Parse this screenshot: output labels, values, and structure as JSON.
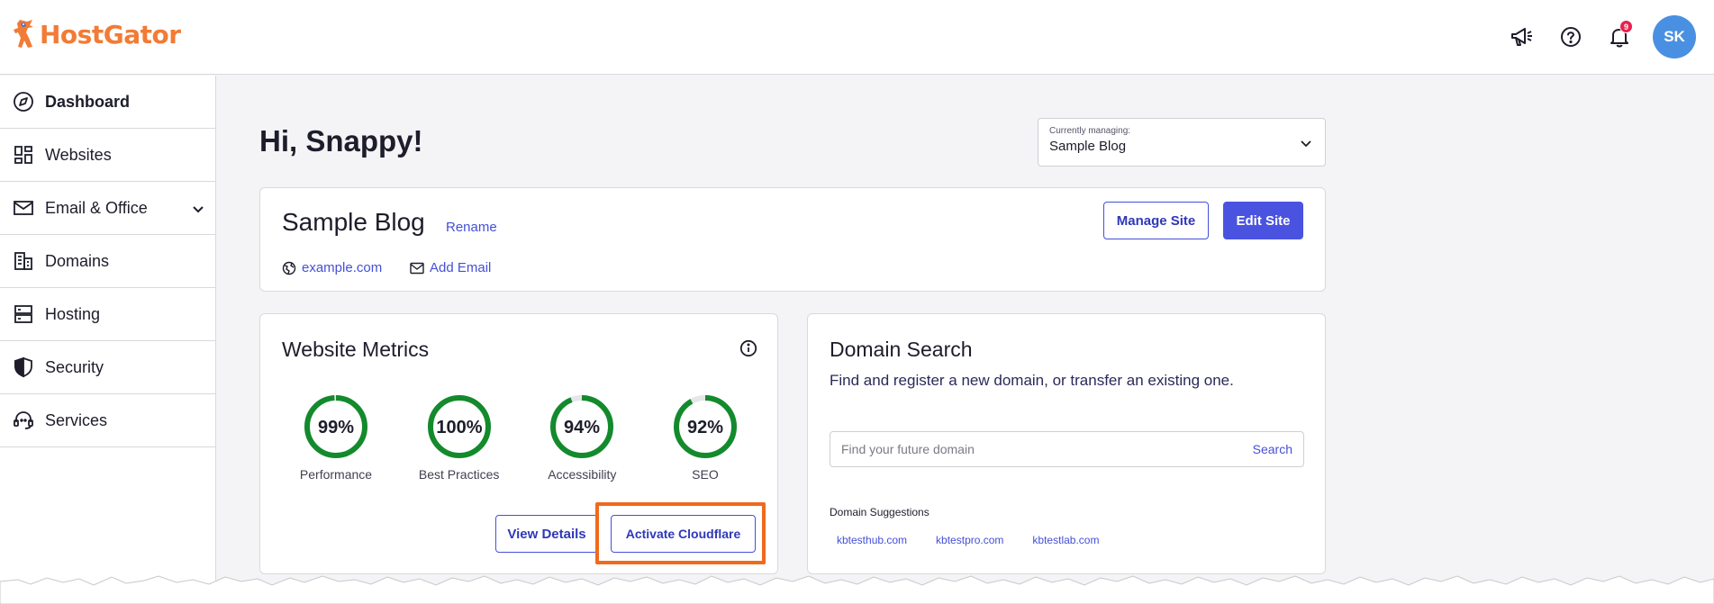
{
  "brand": {
    "name": "HostGator",
    "color": "#f27b35"
  },
  "header": {
    "icons": [
      "megaphone-icon",
      "help-icon",
      "bell-icon"
    ],
    "notification_count": "9",
    "avatar_initials": "SK"
  },
  "sidebar": {
    "items": [
      {
        "label": "Dashboard",
        "icon": "compass-icon",
        "active": true
      },
      {
        "label": "Websites",
        "icon": "grid-icon"
      },
      {
        "label": "Email & Office",
        "icon": "mail-icon",
        "expandable": true
      },
      {
        "label": "Domains",
        "icon": "building-icon"
      },
      {
        "label": "Hosting",
        "icon": "server-icon"
      },
      {
        "label": "Security",
        "icon": "shield-icon"
      },
      {
        "label": "Services",
        "icon": "support-agent-icon"
      }
    ]
  },
  "main": {
    "greeting": "Hi, Snappy!",
    "managing": {
      "label": "Currently managing:",
      "value": "Sample Blog"
    },
    "site": {
      "title": "Sample Blog",
      "rename": "Rename",
      "domain": "example.com",
      "add_email": "Add Email",
      "manage_button": "Manage Site",
      "edit_button": "Edit Site"
    },
    "metrics": {
      "title": "Website Metrics",
      "items": [
        {
          "label": "Performance",
          "value": "99%",
          "fraction": 0.99
        },
        {
          "label": "Best Practices",
          "value": "100%",
          "fraction": 1.0
        },
        {
          "label": "Accessibility",
          "value": "94%",
          "fraction": 0.94
        },
        {
          "label": "SEO",
          "value": "92%",
          "fraction": 0.92
        }
      ],
      "view_details": "View Details",
      "activate_cloudflare": "Activate Cloudflare"
    },
    "domain_search": {
      "title": "Domain Search",
      "subtitle": "Find and register a new domain, or transfer an existing one.",
      "placeholder": "Find your future domain",
      "search_button": "Search",
      "suggestions_title": "Domain Suggestions",
      "suggestions": [
        "kbtesthub.com",
        "kbtestpro.com",
        "kbtestlab.com"
      ]
    }
  },
  "colors": {
    "accent": "#4a53e0",
    "gauge": "#138a2c",
    "highlight": "#ef6a1d"
  }
}
